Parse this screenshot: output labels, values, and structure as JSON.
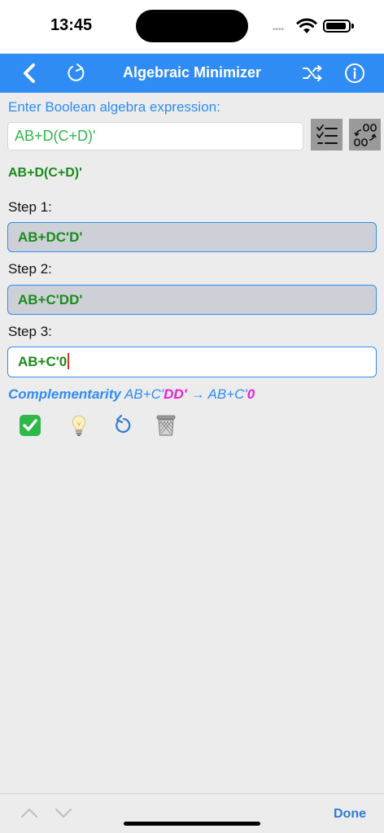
{
  "status": {
    "time": "13:45",
    "signal": "••••"
  },
  "nav": {
    "title": "Algebraic Minimizer",
    "icons": [
      "back-chevron-icon",
      "refresh-icon",
      "shuffle-icon",
      "info-icon"
    ]
  },
  "input": {
    "prompt": "Enter Boolean algebra expression:",
    "value": "AB+D(C+D)'",
    "tools": [
      "checklist-icon",
      "convert-icon"
    ]
  },
  "expression": "AB+D(C+D)'",
  "steps": [
    {
      "label": "Step 1:",
      "value": "AB+DC'D'"
    },
    {
      "label": "Step 2:",
      "value": "AB+C'DD'"
    },
    {
      "label": "Step 3:",
      "value": "AB+C'0"
    }
  ],
  "rule": {
    "name": "Complementarity",
    "before_prefix": "AB+C'",
    "before_highlight": "DD'",
    "arrow": " → ",
    "after_prefix": "AB+C'",
    "after_highlight": "0"
  },
  "actions": [
    "check-icon",
    "hint-bulb-icon",
    "undo-icon",
    "trash-icon"
  ],
  "keyboard_bar": {
    "done_label": "Done"
  },
  "colors": {
    "accent": "#2f8cf5",
    "expression_green": "#1b8a1b",
    "highlight_magenta": "#e620d8"
  }
}
